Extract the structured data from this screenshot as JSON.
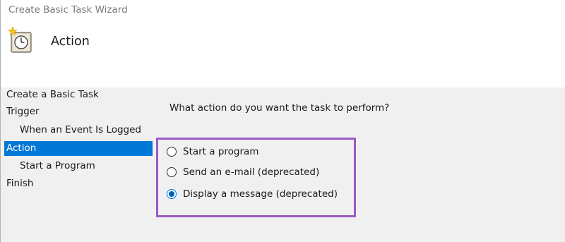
{
  "window": {
    "title": "Create Basic Task Wizard"
  },
  "header": {
    "page_title": "Action",
    "icon": "clock-icon"
  },
  "nav": {
    "items": [
      {
        "label": "Create a Basic Task",
        "indent": false,
        "selected": false
      },
      {
        "label": "Trigger",
        "indent": false,
        "selected": false
      },
      {
        "label": "When an Event Is Logged",
        "indent": true,
        "selected": false
      },
      {
        "label": "Action",
        "indent": false,
        "selected": true
      },
      {
        "label": "Start a Program",
        "indent": true,
        "selected": false
      },
      {
        "label": "Finish",
        "indent": false,
        "selected": false
      }
    ]
  },
  "main": {
    "prompt": "What action do you want the task to perform?",
    "options": [
      {
        "label": "Start a program",
        "checked": false
      },
      {
        "label": "Send an e-mail (deprecated)",
        "checked": false
      },
      {
        "label": "Display a message (deprecated)",
        "checked": true
      }
    ]
  },
  "colors": {
    "selection": "#0078d7",
    "highlight_box": "#9b59c7",
    "panel_bg": "#f0f0f0"
  }
}
